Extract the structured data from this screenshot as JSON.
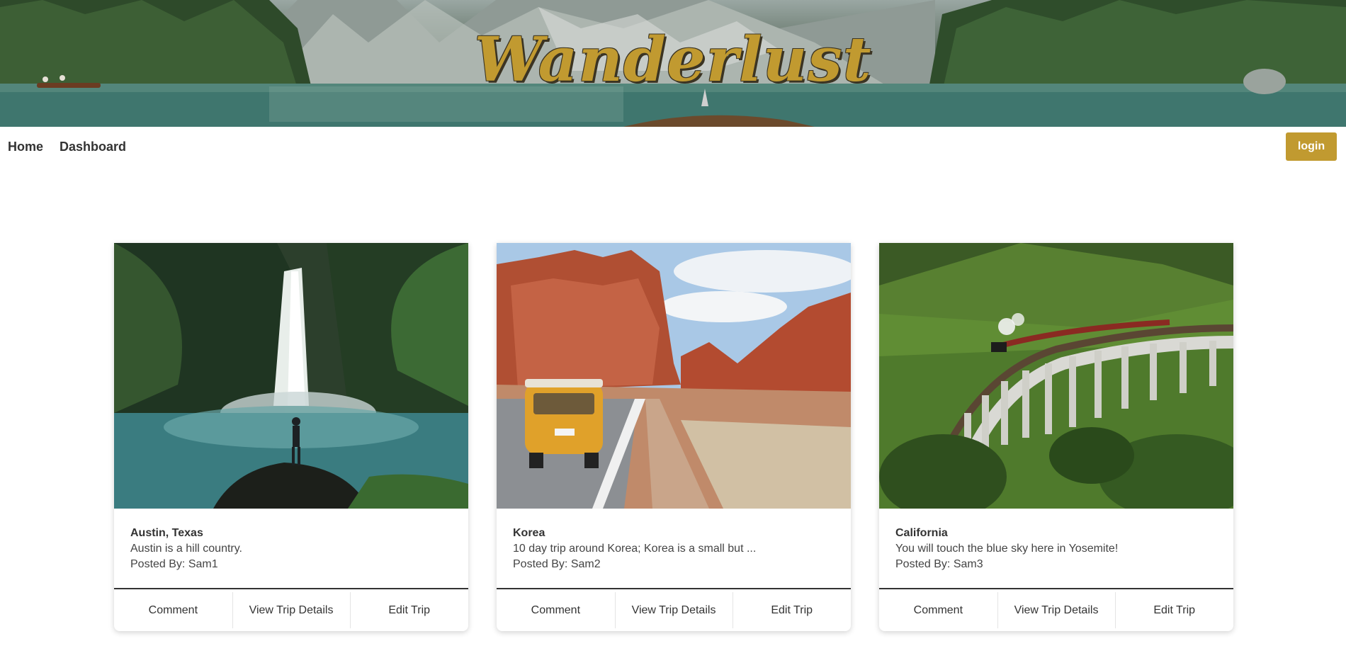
{
  "brand": {
    "title": "Wanderlust",
    "accent_color": "#c19a30"
  },
  "nav": {
    "home_label": "Home",
    "dashboard_label": "Dashboard",
    "login_label": "login"
  },
  "trips": [
    {
      "title": "Austin, Texas",
      "description": "Austin is a hill country.",
      "posted_by": "Posted By: Sam1",
      "image_subject": "waterfall-photo"
    },
    {
      "title": "Korea",
      "description": "10 day trip around Korea; Korea is a small but ...",
      "posted_by": "Posted By: Sam2",
      "image_subject": "desert-road-van-photo"
    },
    {
      "title": "California",
      "description": "You will touch the blue sky here in Yosemite!",
      "posted_by": "Posted By: Sam3",
      "image_subject": "viaduct-train-photo"
    }
  ],
  "card_actions": {
    "comment_label": "Comment",
    "view_label": "View Trip Details",
    "edit_label": "Edit Trip"
  }
}
